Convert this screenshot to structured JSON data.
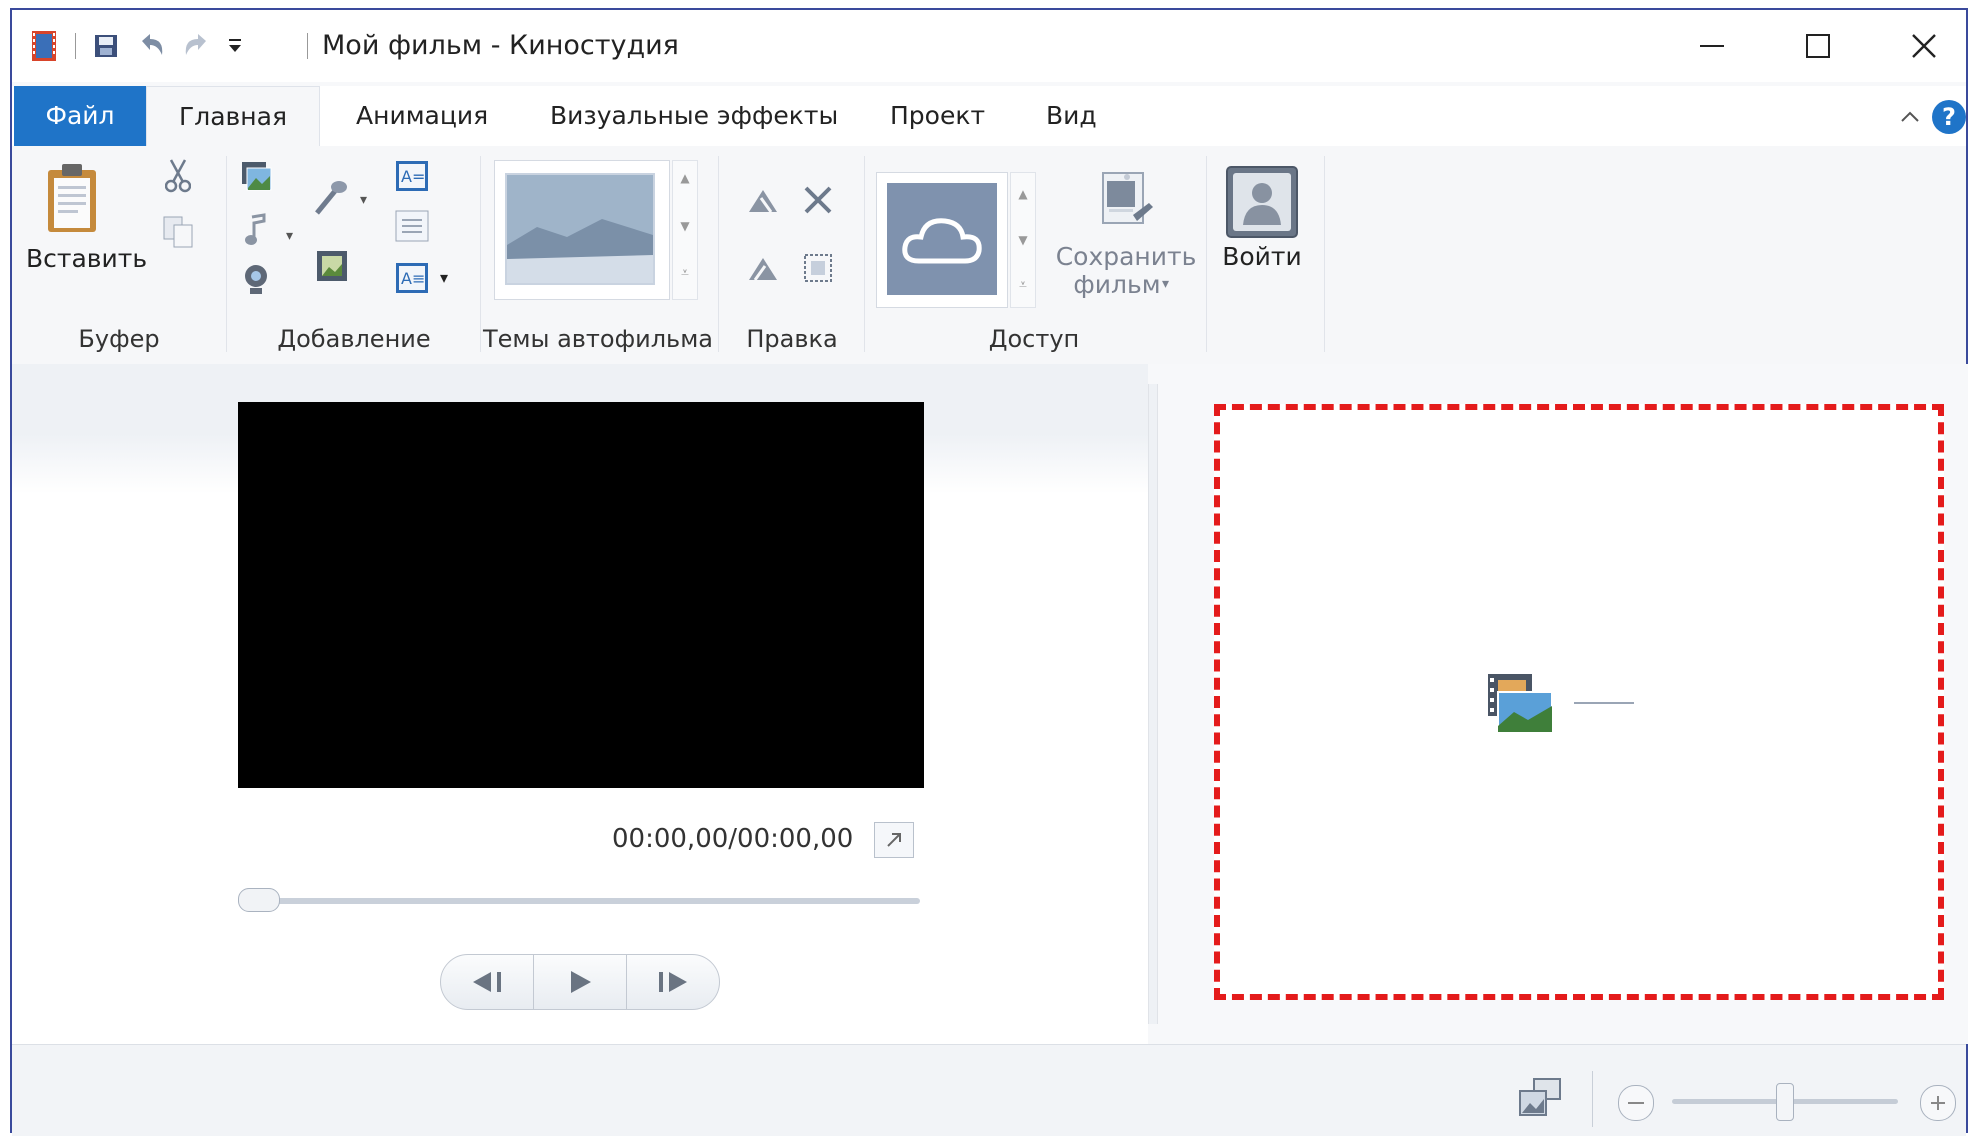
{
  "window": {
    "title": "Мой фильм - Киностудия",
    "minimize": "—",
    "maximize": "☐",
    "close": "✕"
  },
  "tabs": [
    {
      "label": "Файл"
    },
    {
      "label": "Главная"
    },
    {
      "label": "Анимация"
    },
    {
      "label": "Визуальные эффекты"
    },
    {
      "label": "Проект"
    },
    {
      "label": "Вид"
    }
  ],
  "ribbon": {
    "paste_label": "Вставить",
    "save_movie_label_1": "Сохранить",
    "save_movie_label_2": "фильм",
    "signin_label": "Войти",
    "groups": [
      {
        "label": "Буфер"
      },
      {
        "label": "Добавление"
      },
      {
        "label": "Темы автофильма"
      },
      {
        "label": "Правка"
      },
      {
        "label": "Доступ"
      }
    ]
  },
  "player": {
    "time": "00:00,00/00:00,00",
    "position": 0
  },
  "zoom": {
    "level": 0.5
  },
  "colors": {
    "file_tab": "#1f74c8",
    "storyboard_border": "#e41b1b",
    "help": "#1f74c8"
  }
}
